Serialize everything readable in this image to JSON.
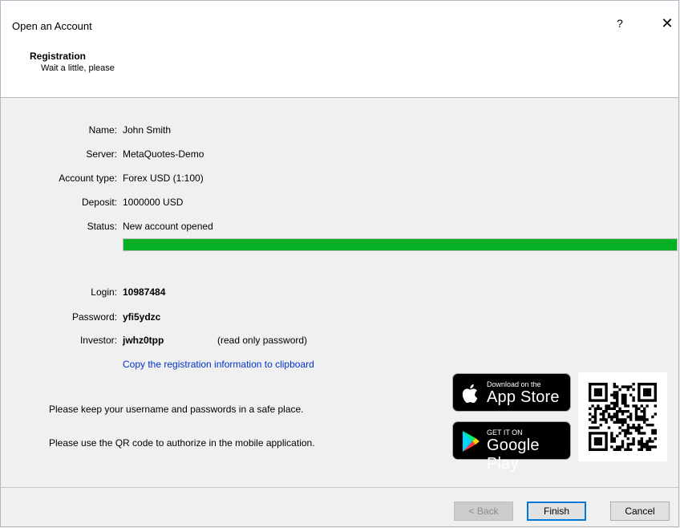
{
  "window": {
    "title": "Open an Account",
    "help_label": "?",
    "close_label": "✕"
  },
  "header": {
    "title": "Registration",
    "subtitle": "Wait a little, please"
  },
  "fields": [
    {
      "label": "Name:",
      "value": "John Smith"
    },
    {
      "label": "Server:",
      "value": "MetaQuotes-Demo"
    },
    {
      "label": "Account type:",
      "value": "Forex USD (1:100)"
    },
    {
      "label": "Deposit:",
      "value": "1000000 USD"
    },
    {
      "label": "Status:",
      "value": "New account opened"
    }
  ],
  "progress": {
    "percent": 100,
    "color": "#06b025"
  },
  "credentials": {
    "login_label": "Login:",
    "login": "10987484",
    "password_label": "Password:",
    "password": "yfi5ydzc",
    "investor_label": "Investor:",
    "investor": "jwhz0tpp",
    "investor_note": "(read only password)"
  },
  "copy_link": "Copy the registration information to clipboard",
  "notes": {
    "keep_safe": "Please keep your username and passwords in a safe place.",
    "qr": "Please use the QR code to authorize in the mobile application."
  },
  "badges": {
    "app_store": {
      "small": "Download on the",
      "big": "App Store"
    },
    "google_play": {
      "small": "GET IT ON",
      "big": "Google Play"
    }
  },
  "buttons": {
    "back": "< Back",
    "finish": "Finish",
    "cancel": "Cancel"
  }
}
